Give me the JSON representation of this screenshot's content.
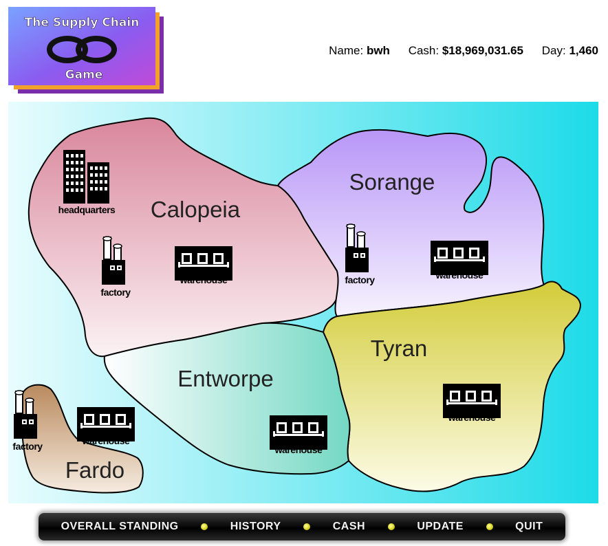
{
  "logo": {
    "line1": "The Supply Chain",
    "line2": "Game"
  },
  "status": {
    "name_label": "Name:",
    "name_value": "bwh",
    "cash_label": "Cash:",
    "cash_value": "$18,969,031.65",
    "day_label": "Day:",
    "day_value": "1,460"
  },
  "map": {
    "regions": {
      "calopeia": "Calopeia",
      "sorange": "Sorange",
      "tyran": "Tyran",
      "entworpe": "Entworpe",
      "fardo": "Fardo"
    },
    "buildings": {
      "headquarters": "headquarters",
      "factory": "factory",
      "warehouse": "warehouse"
    }
  },
  "nav": {
    "overall_standing": "OVERALL STANDING",
    "history": "HISTORY",
    "cash": "CASH",
    "update": "UPDATE",
    "quit": "QUIT"
  },
  "colors": {
    "sea_left": "#e6fbfd",
    "sea_right": "#1ddbe8",
    "calopeia": "#d98da1",
    "sorange": "#b89cf6",
    "tyran": "#d6cf42",
    "entworpe": "#7fdcc8",
    "fardo": "#c8a078",
    "nav_dot": "#d6cf1a"
  }
}
